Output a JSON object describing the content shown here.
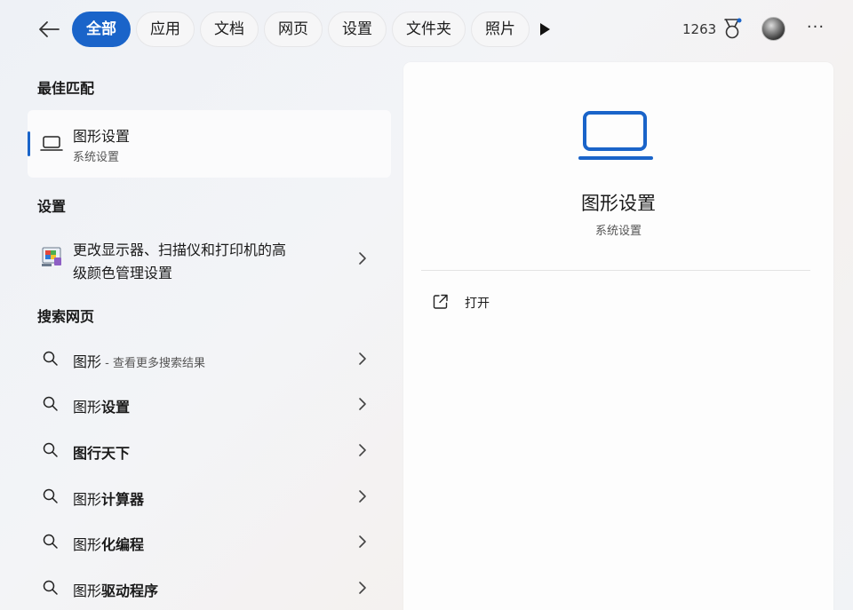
{
  "topbar": {
    "tabs": [
      "全部",
      "应用",
      "文档",
      "网页",
      "设置",
      "文件夹",
      "照片"
    ],
    "points": "1263"
  },
  "sections": {
    "best_match": "最佳匹配",
    "settings": "设置",
    "web_search": "搜索网页"
  },
  "best_match": {
    "title": "图形设置",
    "subtitle": "系统设置",
    "icon": "laptop-icon"
  },
  "settings_item": {
    "line1": "更改显示器、扫描仪和打印机的高",
    "line2": "级颜色管理设置",
    "icon": "color-management-icon"
  },
  "web_results": [
    {
      "prefix": "图形",
      "suffix": "",
      "hint": " - 查看更多搜索结果"
    },
    {
      "prefix": "图形",
      "suffix": "设置",
      "hint": ""
    },
    {
      "prefix": "",
      "suffix": "图行天下",
      "hint": ""
    },
    {
      "prefix": "图形",
      "suffix": "计算器",
      "hint": ""
    },
    {
      "prefix": "图形",
      "suffix": "化编程",
      "hint": ""
    },
    {
      "prefix": "图形",
      "suffix": "驱动程序",
      "hint": ""
    }
  ],
  "detail": {
    "title": "图形设置",
    "subtitle": "系统设置",
    "open_label": "打开"
  },
  "colors": {
    "accent": "#1a64c9",
    "panel": "#fdfdfd"
  }
}
